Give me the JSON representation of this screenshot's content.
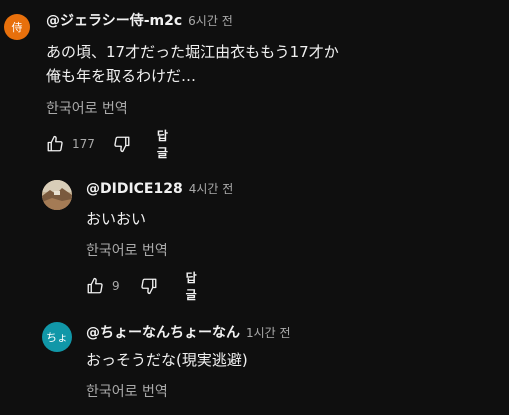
{
  "comments": [
    {
      "avatar_text": "侍",
      "avatar_color": "#e8700c",
      "author": "@ジェラシー侍-m2c",
      "time": "6시간 전",
      "lines": [
        "あの頃、17才だった堀江由衣ももう17才か",
        "俺も年を取るわけだ…"
      ],
      "translate": "한국어로 번역",
      "likes": "177",
      "reply": "답글"
    },
    {
      "avatar_text": "",
      "avatar_color": "#8a6a4a",
      "author": "@DIDICE128",
      "time": "4시간 전",
      "lines": [
        "おいおい"
      ],
      "translate": "한국어로 번역",
      "likes": "9",
      "reply": "답글"
    },
    {
      "avatar_text": "ちょ",
      "avatar_color": "#1197a8",
      "author": "@ちょーなんちょーなん",
      "time": "1시간 전",
      "lines": [
        "おっそうだな(現実逃避)"
      ],
      "translate": "한국어로 번역"
    }
  ]
}
